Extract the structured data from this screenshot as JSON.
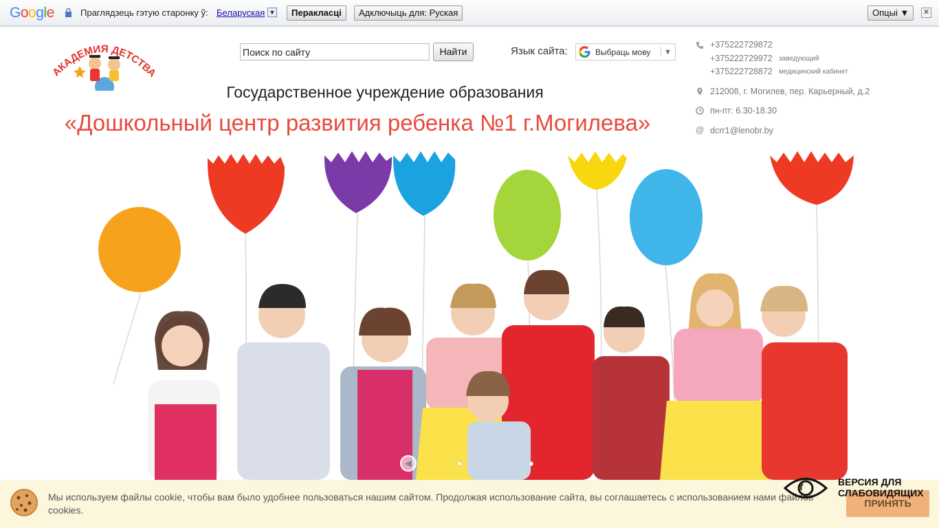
{
  "translate_bar": {
    "logo": "Google",
    "prompt": "Праглядзець гэтую старонку ў:",
    "language": "Беларуская",
    "translate_button": "Перакласці",
    "turn_off_button": "Адключыць для: Руская",
    "options_button": "Опцыі ▼",
    "close": "✕"
  },
  "header": {
    "logo_text": "АКАДЕМИЯ ДЕТСТВА",
    "search_placeholder": "Поиск по сайту",
    "search_button": "Найти",
    "lang_label": "Язык сайта:",
    "lang_select": "Выбраць мову",
    "subtitle": "Государственное учреждение образования",
    "title": "«Дошкольный центр развития ребенка №1 г.Могилева»"
  },
  "contacts": {
    "phone1": "+375222729872",
    "phone2": "+375222729972",
    "phone2_note": "заведующий",
    "phone3": "+375222728872",
    "phone3_note": "медицинский кабинет",
    "address": "212008, г. Могилев, пер. Карьерный, д.2",
    "hours": "пн-пт: 6.30-18.30",
    "email": "dcrr1@lenobr.by"
  },
  "cookie": {
    "text": "Мы используем файлы cookie, чтобы вам было удобнее пользоваться нашим сайтом. Продолжая использование сайта, вы соглашаетесь с использованием нами файлов cookies.",
    "accept": "ПРИНЯТЬ"
  },
  "low_vision": {
    "line1": "ВЕРСИЯ ДЛЯ",
    "line2": "СЛАБОВИДЯЩИХ"
  },
  "colors": {
    "title": "#e8493d",
    "cookie_bg": "#fcf6dd",
    "accept_bg": "#f0b27a"
  }
}
